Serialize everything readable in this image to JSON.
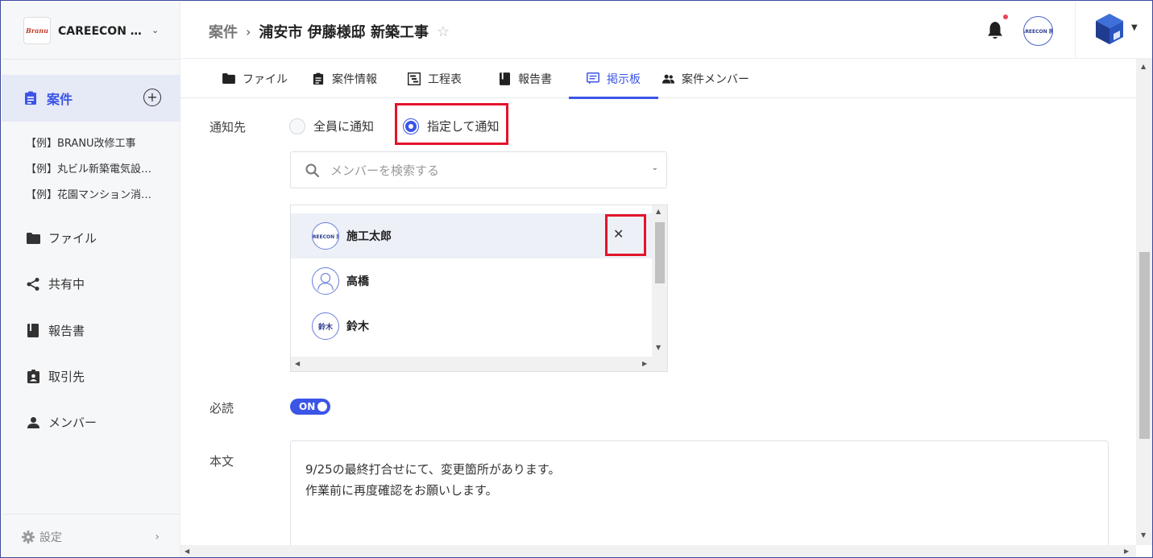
{
  "sidebar": {
    "brand": {
      "logo_text": "Branu",
      "name": "CAREECON 施工管理"
    },
    "active": {
      "label": "案件"
    },
    "sub_items": [
      "【例】BRANU改修工事",
      "【例】丸ビル新築電気設備工事",
      "【例】花園マンション消防設備工事"
    ],
    "items": [
      {
        "label": "ファイル",
        "icon": "folder-icon"
      },
      {
        "label": "共有中",
        "icon": "share-icon"
      },
      {
        "label": "報告書",
        "icon": "book-icon"
      },
      {
        "label": "取引先",
        "icon": "contact-badge-icon"
      },
      {
        "label": "メンバー",
        "icon": "person-icon"
      }
    ],
    "settings": {
      "label": "設定"
    }
  },
  "header": {
    "breadcrumb_root": "案件",
    "breadcrumb_current": "浦安市 伊藤様邸 新築工事",
    "avatar_text": "CAREECON 施工"
  },
  "tabs": [
    {
      "label": "ファイル",
      "icon": "folder-icon"
    },
    {
      "label": "案件情報",
      "icon": "clipboard-icon"
    },
    {
      "label": "工程表",
      "icon": "gantt-icon"
    },
    {
      "label": "報告書",
      "icon": "book-icon"
    },
    {
      "label": "掲示板",
      "icon": "message-board-icon",
      "active": true
    },
    {
      "label": "案件メンバー",
      "icon": "group-icon"
    }
  ],
  "form": {
    "notify_label": "通知先",
    "radio_all": "全員に通知",
    "radio_specific": "指定して通知",
    "search_placeholder": "メンバーを検索する",
    "members": [
      {
        "name": "施工太郎",
        "avatar_text": "CAREECON 施工",
        "selected": true
      },
      {
        "name": "高橋",
        "avatar_text": ""
      },
      {
        "name": "鈴木",
        "avatar_text": "鈴木"
      }
    ],
    "required_label": "必読",
    "toggle_text": "ON",
    "body_label": "本文",
    "body_lines": [
      "9/25の最終打合せにて、変更箇所があります。",
      "作業前に再度確認をお願いします。"
    ]
  },
  "colors": {
    "accent": "#3b55e6",
    "highlight": "#e3142a",
    "notify_dot": "#e8445a"
  }
}
